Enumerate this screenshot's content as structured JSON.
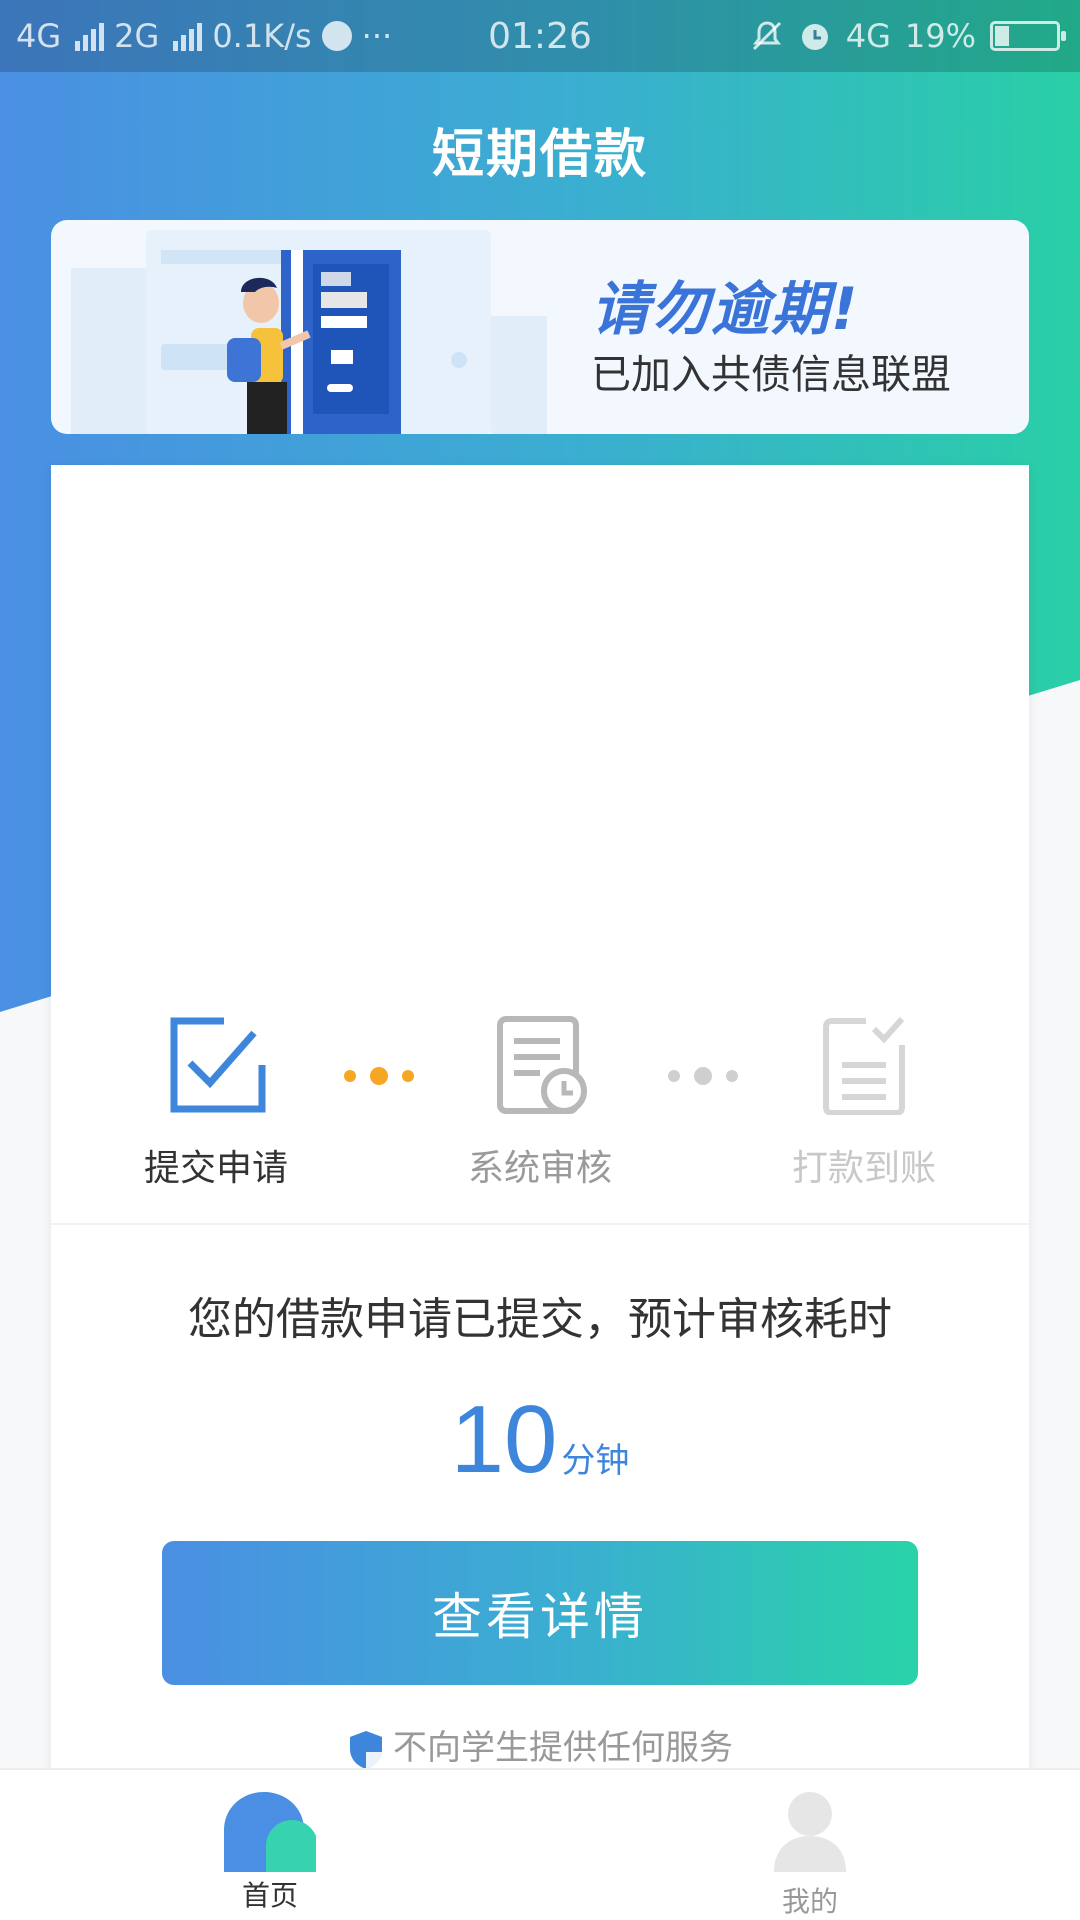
{
  "status_bar": {
    "network_1": "4G",
    "network_2": "2G",
    "speed": "0.1K/s",
    "more": "···",
    "time": "01:26",
    "network_right": "4G",
    "battery": "19%"
  },
  "header": {
    "title": "短期借款"
  },
  "banner": {
    "headline": "请勿逾期!",
    "subline": "已加入共债信息联盟"
  },
  "steps": [
    {
      "label": "提交申请",
      "state": "done",
      "icon": "checkbox-icon"
    },
    {
      "label": "系统审核",
      "state": "pending",
      "icon": "document-clock-icon"
    },
    {
      "label": "打款到账",
      "state": "inactive",
      "icon": "document-check-icon"
    }
  ],
  "status": {
    "message": "您的借款申请已提交，预计审核耗时",
    "eta_value": "10",
    "eta_unit": "分钟"
  },
  "actions": {
    "detail_button": "查看详情"
  },
  "notice": {
    "text": "不向学生提供任何服务",
    "icon": "shield-icon"
  },
  "tabbar": {
    "home_label": "首页",
    "mine_label": "我的"
  },
  "colors": {
    "gradient_start": "#4a8fe3",
    "gradient_end": "#29cfa6",
    "accent_blue": "#3d86dc",
    "active_dots": "#f5a623"
  }
}
